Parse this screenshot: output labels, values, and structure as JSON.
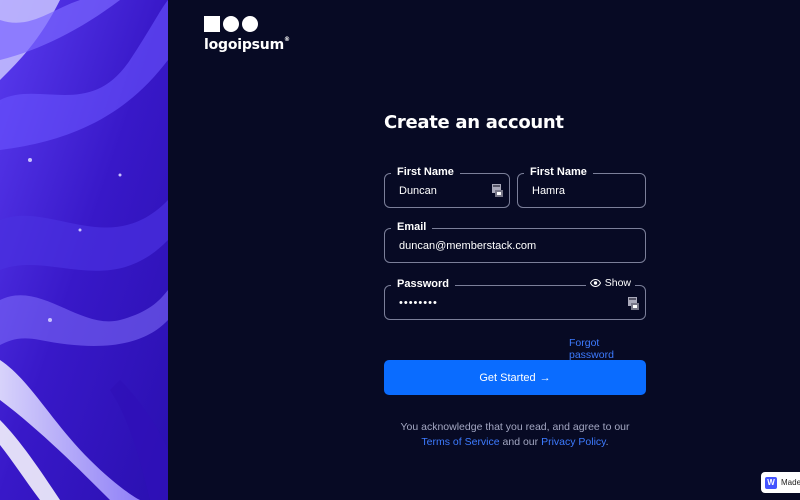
{
  "brand": {
    "name": "logoipsum",
    "mark": "®"
  },
  "form": {
    "title": "Create an account",
    "first_name_1": {
      "label": "First Name",
      "value": "Duncan"
    },
    "first_name_2": {
      "label": "First Name",
      "value": "Hamra"
    },
    "email": {
      "label": "Email",
      "value": "duncan@memberstack.com"
    },
    "password": {
      "label": "Password",
      "value": "••••••••",
      "show_label": "Show"
    },
    "forgot": "Forgot password",
    "submit": "Get Started",
    "submit_arrow": "→",
    "terms": {
      "prefix": "You acknowledge that you read, and agree to our",
      "tos": "Terms of Service",
      "and_our": "and our",
      "privacy": "Privacy Policy",
      "suffix": "."
    }
  },
  "badge": {
    "label": "Made"
  },
  "colors": {
    "background": "#070a24",
    "accent": "#0a6cff",
    "link": "#3d7bff",
    "hero": "#3a1fd0"
  }
}
